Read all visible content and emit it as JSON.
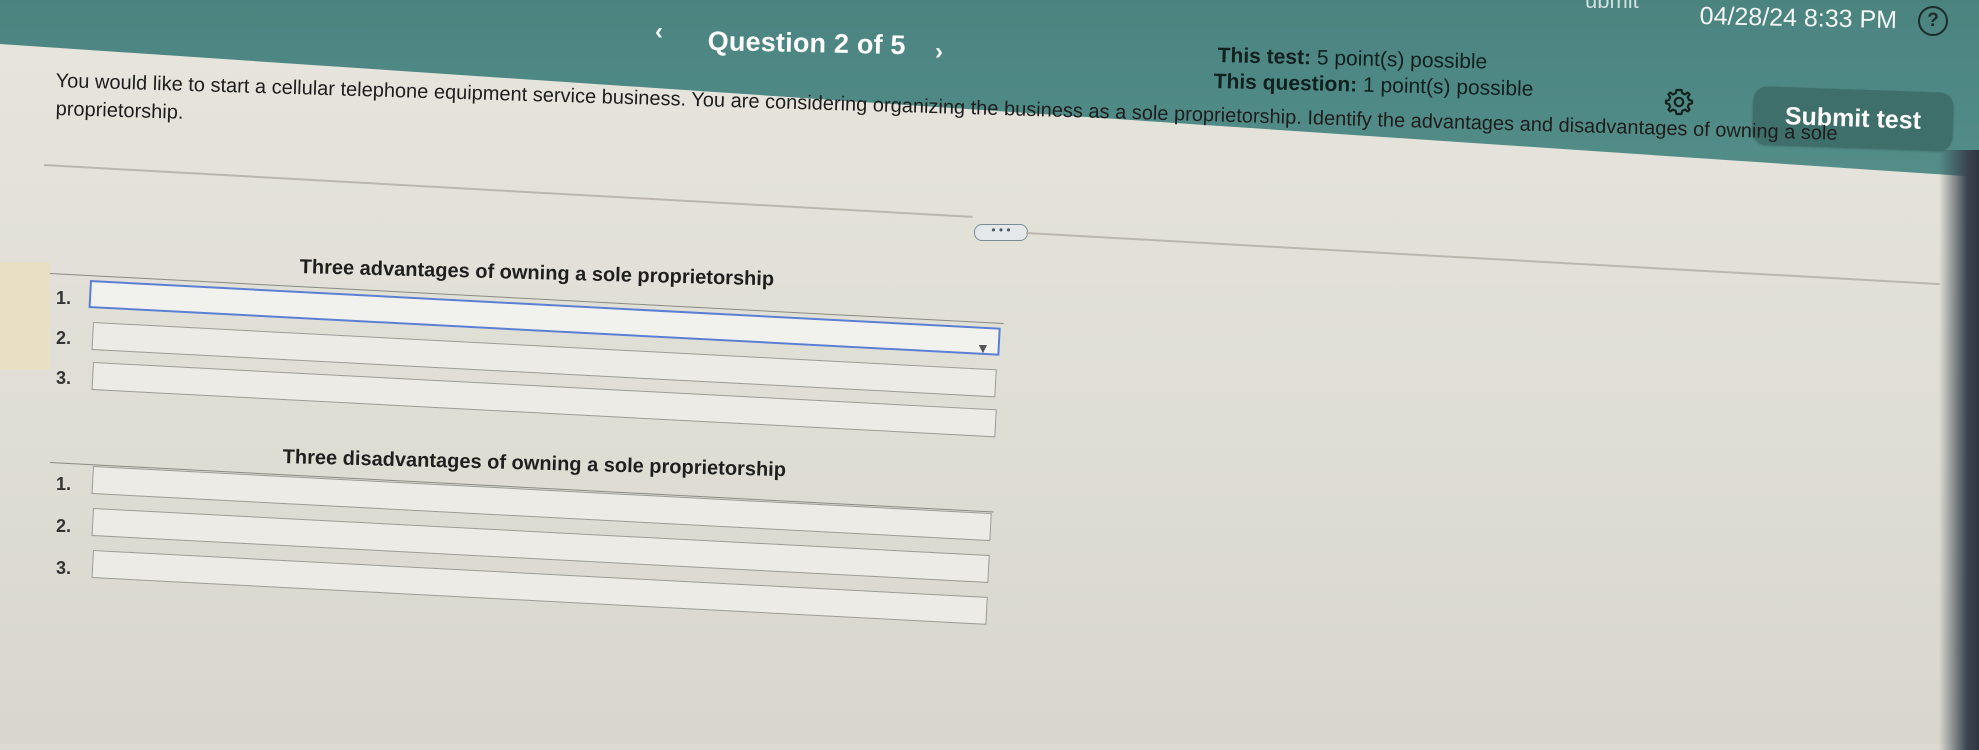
{
  "header": {
    "prev_arrow": "‹",
    "question_label": "Question 2 of 5",
    "next_arrow": "›",
    "datetime": "04/28/24 8:33 PM",
    "datetime_fragment": "ubmit",
    "help_symbol": "?",
    "test_points_label": "This test:",
    "test_points_value": "5 point(s) possible",
    "question_points_label": "This question:",
    "question_points_value": "1 point(s) possible",
    "submit_label": "Submit test"
  },
  "question": {
    "text_line1": "You would like to start a cellular telephone equipment service business. You are considering organizing the business as a sole proprietorship. Identify the advantages and disadvantages of owning a sole",
    "text_line2": "proprietorship."
  },
  "more_label": "• • •",
  "advantages": {
    "heading": "Three advantages of owning a sole proprietorship",
    "items": [
      {
        "number": "1.",
        "value": ""
      },
      {
        "number": "2.",
        "value": ""
      },
      {
        "number": "3.",
        "value": ""
      }
    ]
  },
  "disadvantages": {
    "heading": "Three disadvantages of owning a sole proprietorship",
    "items": [
      {
        "number": "1.",
        "value": ""
      },
      {
        "number": "2.",
        "value": ""
      },
      {
        "number": "3.",
        "value": ""
      }
    ]
  },
  "dropdown_arrow": "▼",
  "colors": {
    "header_bg": "#4f8985",
    "submit_bg": "#3f6f6b",
    "active_border": "#5b7fd2"
  }
}
